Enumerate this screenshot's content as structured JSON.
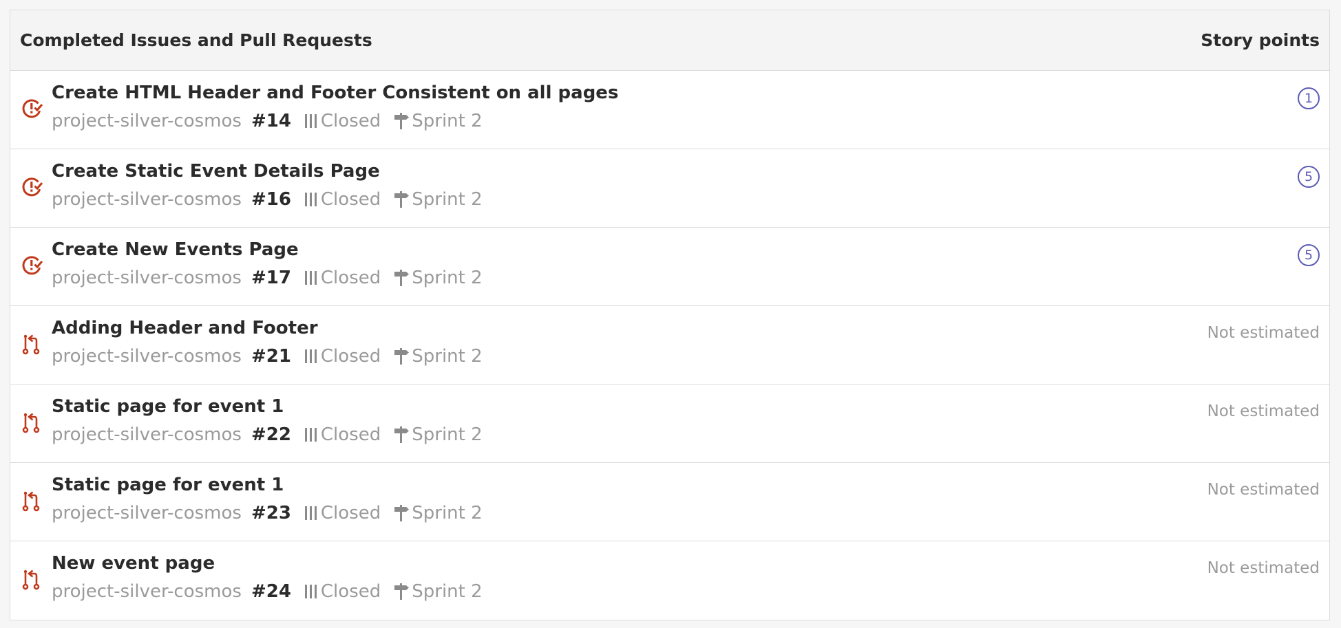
{
  "header": {
    "title": "Completed Issues and Pull Requests",
    "points_title": "Story points"
  },
  "colors": {
    "accent_icon": "#c0391b",
    "badge": "#5b5bb5",
    "muted_text": "#9a9a9a"
  },
  "rows": [
    {
      "kind": "issue",
      "icon": "issue-closed-icon",
      "title": "Create HTML Header and Footer Consistent on all pages",
      "repo": "project-silver-cosmos",
      "number": "#14",
      "status": "Closed",
      "sprint": "Sprint 2",
      "points": "1",
      "estimated": true
    },
    {
      "kind": "issue",
      "icon": "issue-closed-icon",
      "title": "Create Static Event Details Page",
      "repo": "project-silver-cosmos",
      "number": "#16",
      "status": "Closed",
      "sprint": "Sprint 2",
      "points": "5",
      "estimated": true
    },
    {
      "kind": "issue",
      "icon": "issue-closed-icon",
      "title": "Create New Events Page",
      "repo": "project-silver-cosmos",
      "number": "#17",
      "status": "Closed",
      "sprint": "Sprint 2",
      "points": "5",
      "estimated": true
    },
    {
      "kind": "pr",
      "icon": "pull-request-icon",
      "title": "Adding Header and Footer",
      "repo": "project-silver-cosmos",
      "number": "#21",
      "status": "Closed",
      "sprint": "Sprint 2",
      "points": "Not estimated",
      "estimated": false
    },
    {
      "kind": "pr",
      "icon": "pull-request-icon",
      "title": "Static page for event 1",
      "repo": "project-silver-cosmos",
      "number": "#22",
      "status": "Closed",
      "sprint": "Sprint 2",
      "points": "Not estimated",
      "estimated": false
    },
    {
      "kind": "pr",
      "icon": "pull-request-icon",
      "title": "Static page for event 1",
      "repo": "project-silver-cosmos",
      "number": "#23",
      "status": "Closed",
      "sprint": "Sprint 2",
      "points": "Not estimated",
      "estimated": false
    },
    {
      "kind": "pr",
      "icon": "pull-request-icon",
      "title": "New event page",
      "repo": "project-silver-cosmos",
      "number": "#24",
      "status": "Closed",
      "sprint": "Sprint 2",
      "points": "Not estimated",
      "estimated": false
    }
  ]
}
